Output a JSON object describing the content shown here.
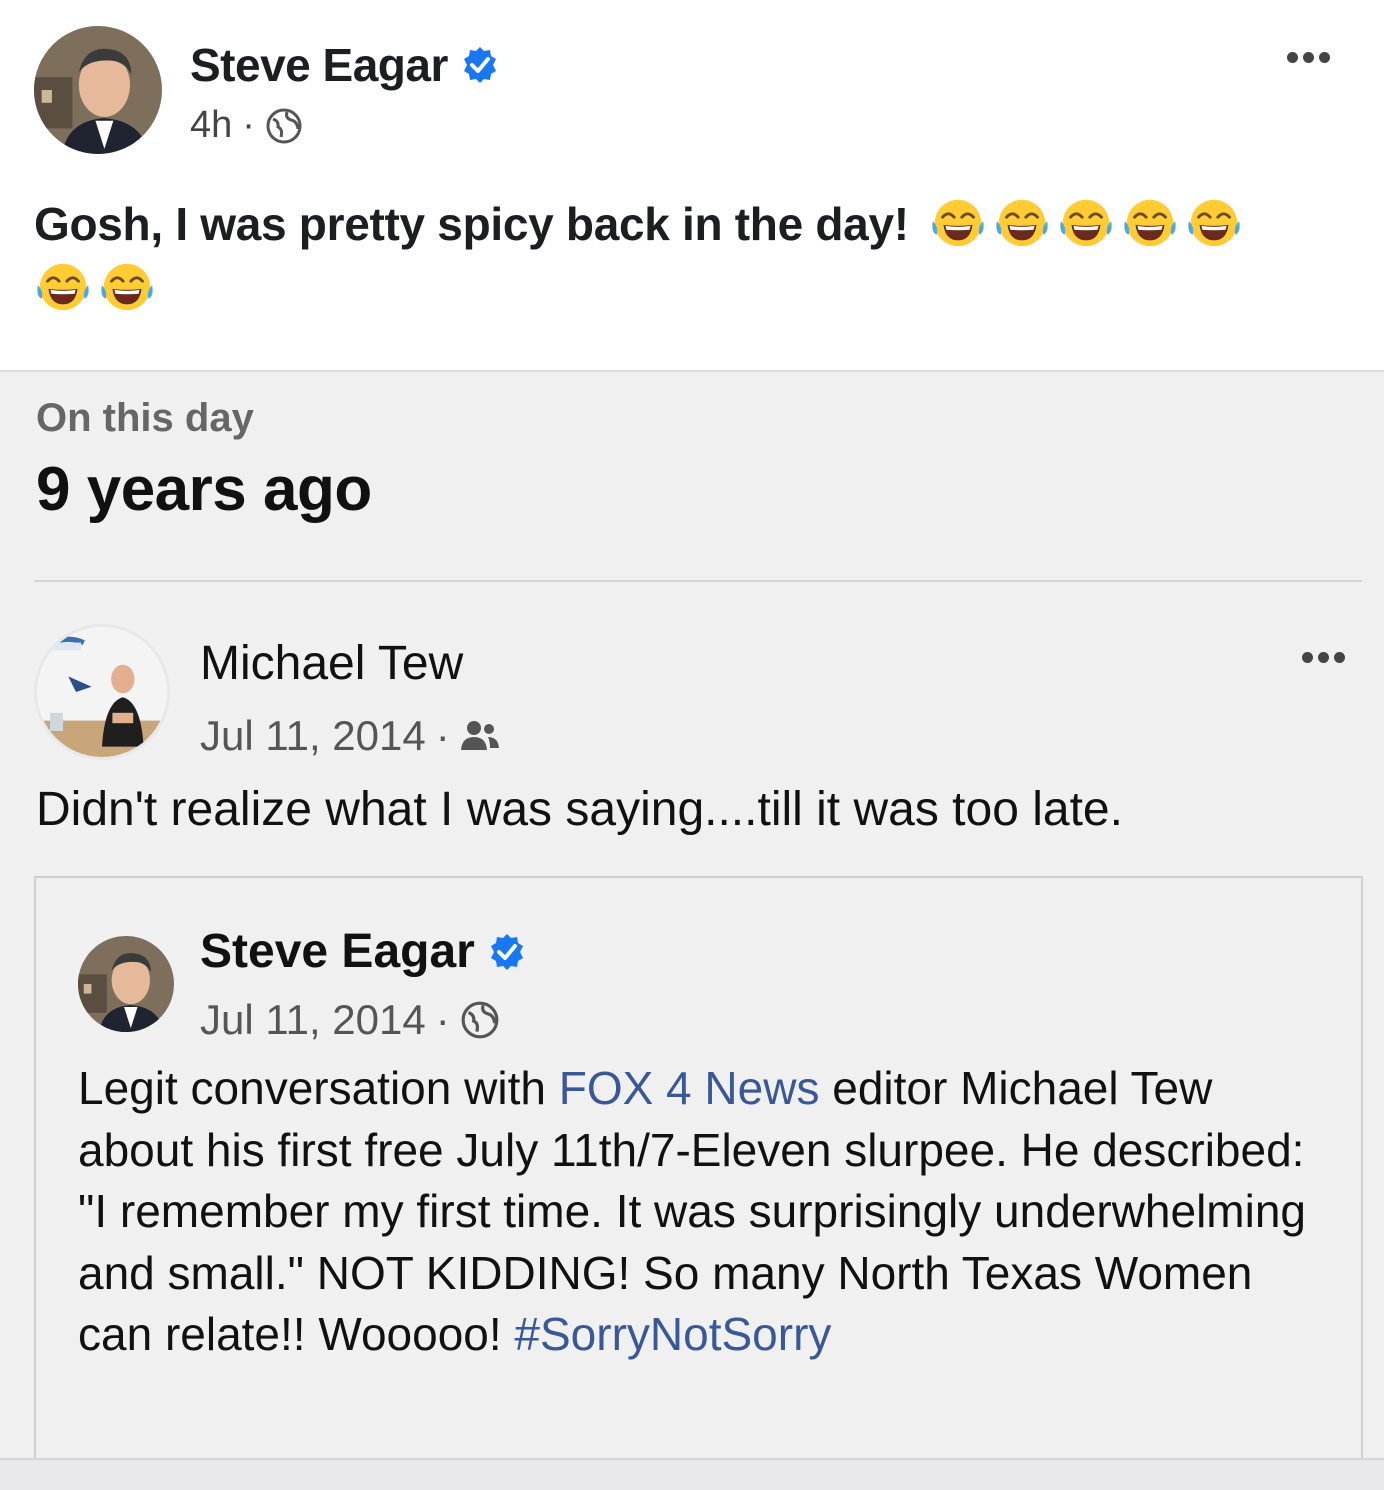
{
  "colors": {
    "link": "#385898",
    "verified": "#1877f2",
    "memory_bg": "#f0f0f1"
  },
  "top_post": {
    "author": "Steve Eagar",
    "verified": true,
    "time": "4h",
    "separator": "·",
    "audience_icon": "globe-icon",
    "text": "Gosh, I was pretty spicy back in the day!",
    "emoji": "face-with-tears-of-joy",
    "emoji_count": 7
  },
  "memory": {
    "label": "On this day",
    "years_ago": "9 years ago"
  },
  "shared_post": {
    "author": "Michael Tew",
    "date": "Jul 11, 2014",
    "separator": "·",
    "audience_icon": "friends-icon",
    "text": "Didn't realize what I was saying....till it was too late."
  },
  "original_post": {
    "author": "Steve Eagar",
    "verified": true,
    "date": "Jul 11, 2014",
    "separator": "·",
    "audience_icon": "globe-icon",
    "text_1": "Legit conversation with ",
    "link": "FOX 4 News",
    "text_2": " editor Michael Tew about his first free July 11th/7-Eleven slurpee. He described: \"I remember my first time. It was surprisingly underwhelming and small.\" NOT KIDDING!  So many North Texas Women can relate!! Wooooo! ",
    "hashtag": "#SorryNotSorry"
  }
}
